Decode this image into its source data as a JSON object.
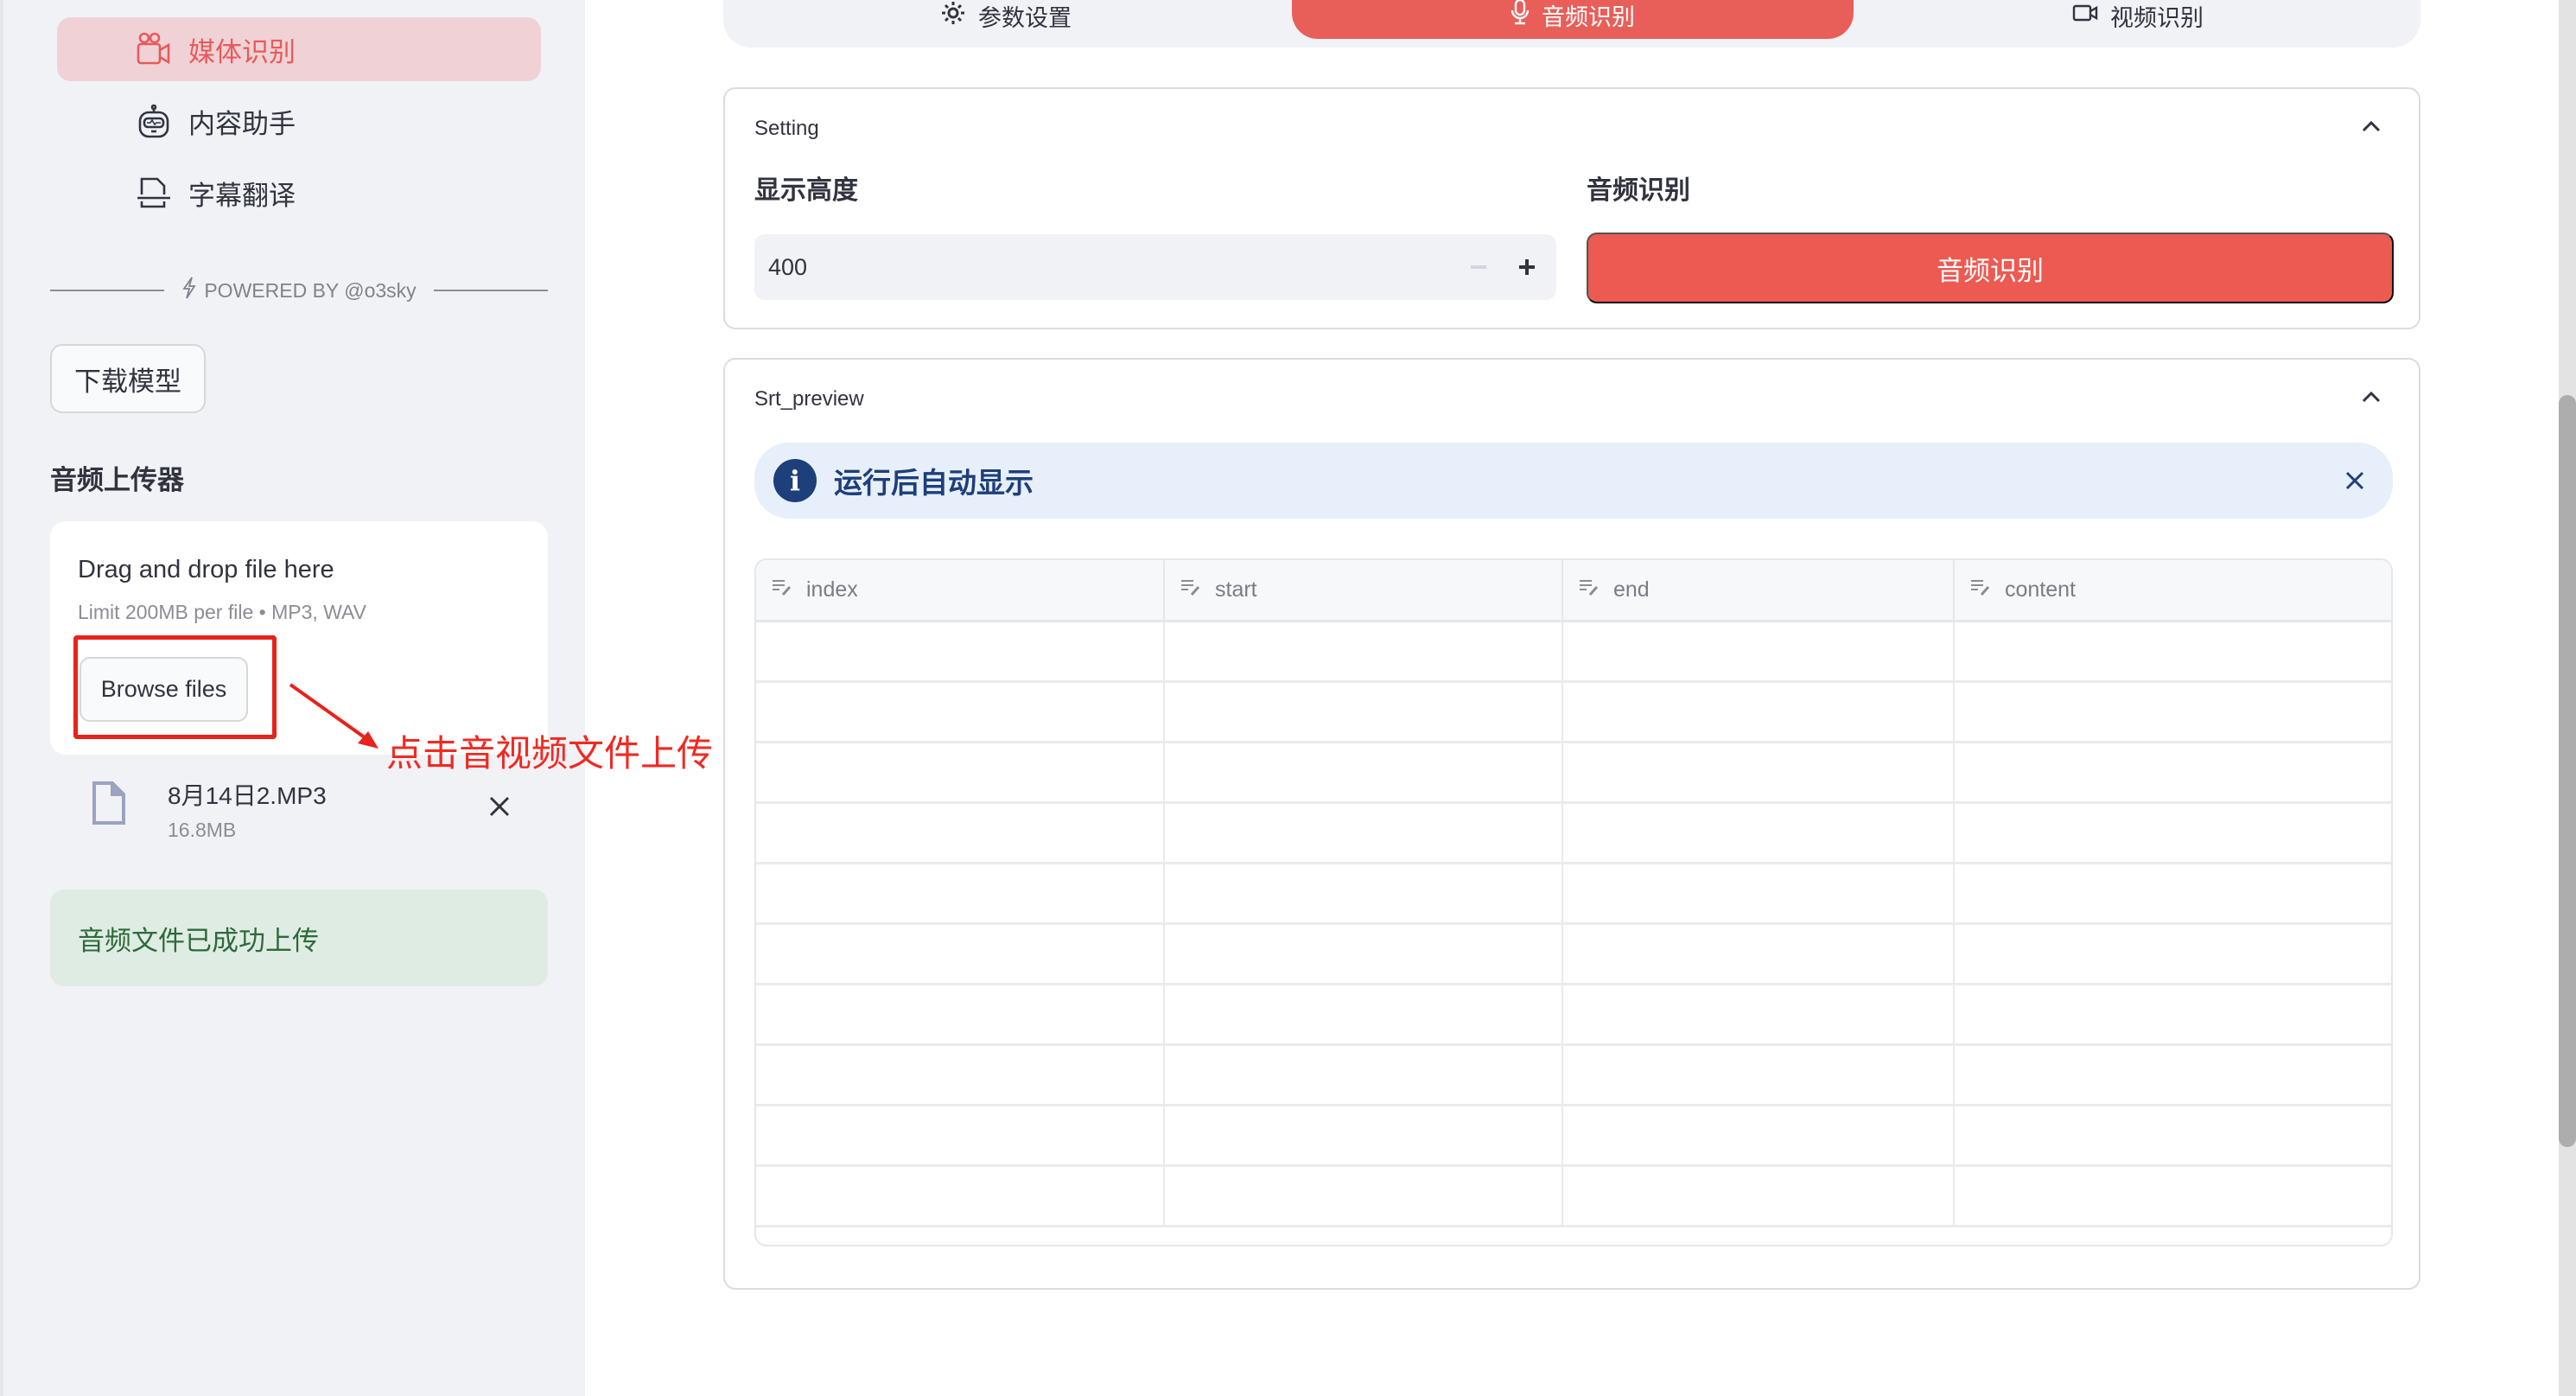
{
  "sidebar": {
    "nav": [
      {
        "label": "媒体识别",
        "icon": "video-camera-icon",
        "active": true
      },
      {
        "label": "内容助手",
        "icon": "robot-icon",
        "active": false
      },
      {
        "label": "字幕翻译",
        "icon": "subtitle-file-icon",
        "active": false
      }
    ],
    "powered_by": "POWERED BY @o3sky",
    "download_button": "下载模型",
    "uploader": {
      "title": "音频上传器",
      "drop_text": "Drag and drop file here",
      "limit_text": "Limit 200MB per file • MP3, WAV",
      "browse_button": "Browse files",
      "file": {
        "name": "8月14日2.MP3",
        "size": "16.8MB"
      },
      "success_message": "音频文件已成功上传"
    },
    "annotation": "点击音视频文件上传"
  },
  "tabs": [
    {
      "label": "参数设置",
      "icon": "gear-icon",
      "active": false
    },
    {
      "label": "音频识别",
      "icon": "microphone-icon",
      "active": true
    },
    {
      "label": "视频识别",
      "icon": "video-icon",
      "active": false
    }
  ],
  "setting_card": {
    "title": "Setting",
    "height_label": "显示高度",
    "height_value": "400",
    "recognize_label": "音频识别",
    "recognize_button": "音频识别"
  },
  "preview_card": {
    "title": "Srt_preview",
    "info_message": "运行后自动显示",
    "columns": [
      "index",
      "start",
      "end",
      "content"
    ],
    "row_count": 10,
    "rows": []
  },
  "colors": {
    "accent": "#e85f5a",
    "active_nav_bg": "#f0d2d6",
    "success_bg": "#dfece4",
    "info_bg": "#e7effa",
    "info_fg": "#1d3f7a",
    "annotation": "#e8221c"
  }
}
